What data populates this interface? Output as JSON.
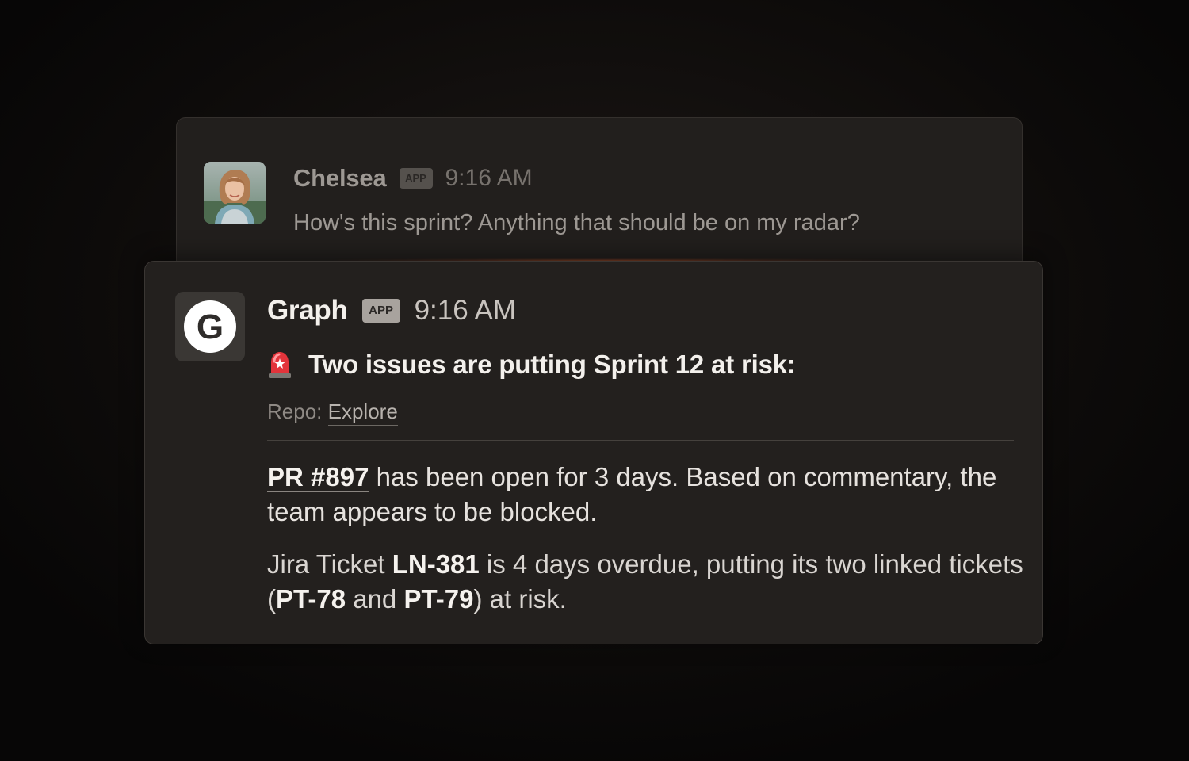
{
  "back_message": {
    "author": "Chelsea",
    "badge": "APP",
    "time": "9:16 AM",
    "text": "How's this sprint? Anything that should be on my radar?"
  },
  "front_message": {
    "author": "Graph",
    "logo_letter": "G",
    "badge": "APP",
    "time": "9:16 AM",
    "headline": "Two issues are putting Sprint 12 at risk:",
    "repo_label": "Repo:",
    "repo_name": "Explore",
    "para1": {
      "pr_link": "PR #897",
      "text": " has been open for 3 days. Based on commentary, the team appears to be blocked."
    },
    "para2": {
      "prefix": "Jira Ticket ",
      "ticket_link": "LN-381",
      "middle": " is 4 days overdue, putting its two linked tickets (",
      "link_a": "PT-78",
      "and_text": " and ",
      "link_b": "PT-79",
      "suffix": ") at risk."
    }
  },
  "icons": {
    "siren": "siren-icon",
    "logo": "graph-logo-icon",
    "avatar": "user-avatar"
  },
  "colors": {
    "glow": "#f06e32",
    "card_bg": "#23201e",
    "page_bg": "#0d0b0a"
  }
}
